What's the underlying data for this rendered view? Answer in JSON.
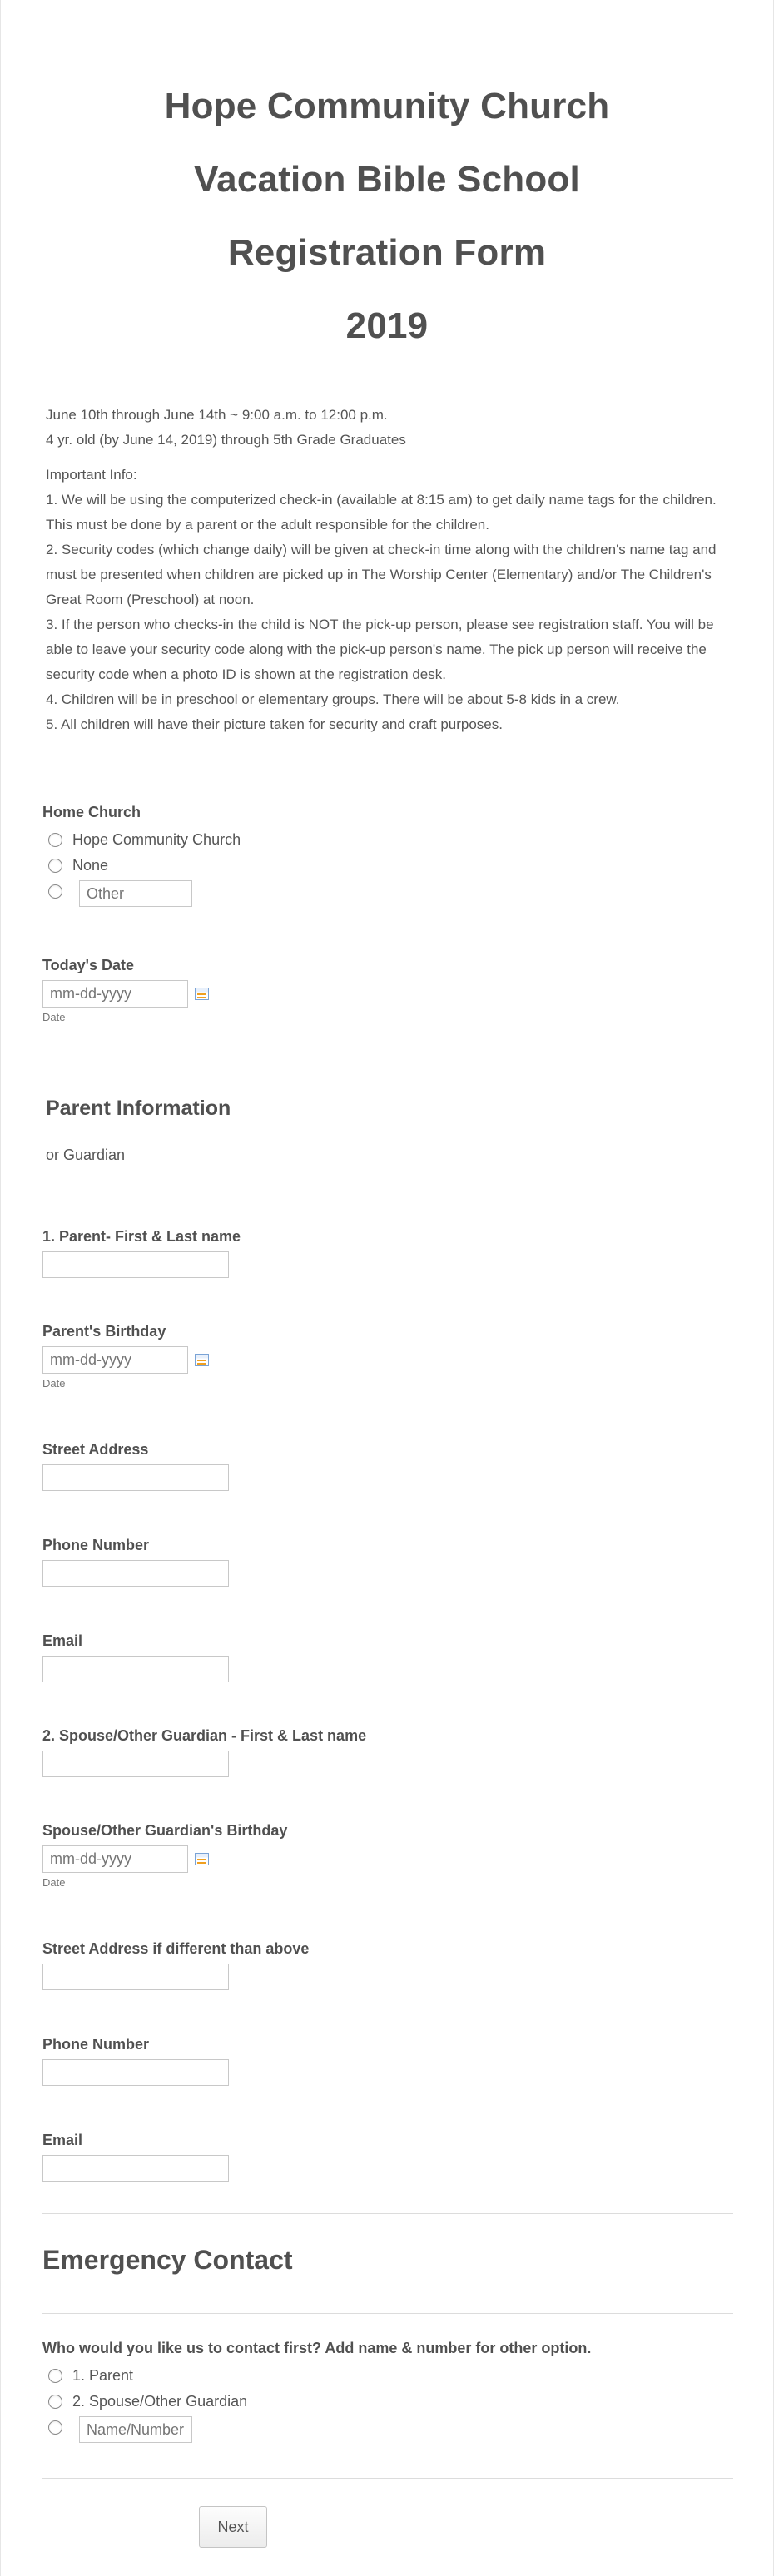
{
  "header": {
    "line1": "Hope Community Church",
    "line2": "Vacation Bible School",
    "line3": "Registration Form",
    "line4": "2019"
  },
  "intro": {
    "dates": "June 10th through June 14th ~ 9:00 a.m. to 12:00 p.m.",
    "ages": "4 yr. old (by June 14, 2019) through 5th Grade Graduates",
    "important_heading": "Important Info:",
    "items": [
      "1. We will be using the computerized check-in (available at 8:15 am) to get daily name tags for the children. This must be done by a parent or the adult responsible for the children.",
      "2. Security codes (which change daily) will be given at check-in time along with the children's name tag and must be presented when children are picked up in The Worship Center (Elementary) and/or The Children's Great Room (Preschool) at noon.",
      "3. If the person who checks-in the child is NOT the pick-up person, please see registration staff. You will be able to leave your security code along with the pick-up person's name. The pick up person will receive the security code when a photo ID is shown at the registration desk.",
      "4. Children will be in preschool or elementary groups. There will be about 5-8 kids in a crew.",
      "5. All children will have their picture taken for security and craft purposes."
    ]
  },
  "home_church": {
    "label": "Home Church",
    "options": [
      "Hope Community Church",
      "None"
    ],
    "other_placeholder": "Other"
  },
  "todays_date": {
    "label": "Today's Date",
    "placeholder": "mm-dd-yyyy",
    "sublabel": "Date"
  },
  "parent_section": {
    "title": "Parent Information",
    "subtitle": "or Guardian"
  },
  "parent_name": {
    "label": "1. Parent- First & Last name",
    "value": ""
  },
  "parent_birthday": {
    "label": "Parent's Birthday",
    "placeholder": "mm-dd-yyyy",
    "sublabel": "Date"
  },
  "street_address": {
    "label": "Street Address",
    "value": ""
  },
  "phone_number": {
    "label": "Phone Number",
    "value": ""
  },
  "email": {
    "label": "Email",
    "value": ""
  },
  "spouse_name": {
    "label": "2. Spouse/Other Guardian - First & Last name",
    "value": ""
  },
  "spouse_birthday": {
    "label": "Spouse/Other Guardian's Birthday",
    "placeholder": "mm-dd-yyyy",
    "sublabel": "Date"
  },
  "street_address_2": {
    "label": "Street Address if different than above",
    "value": ""
  },
  "phone_number_2": {
    "label": "Phone Number",
    "value": ""
  },
  "email_2": {
    "label": "Email",
    "value": ""
  },
  "emergency": {
    "title": "Emergency Contact",
    "question": "Who would you like us to contact first? Add name & number for other option.",
    "options": [
      "1. Parent",
      "2. Spouse/Other Guardian"
    ],
    "other_placeholder": "Name/Number"
  },
  "next_button": "Next"
}
